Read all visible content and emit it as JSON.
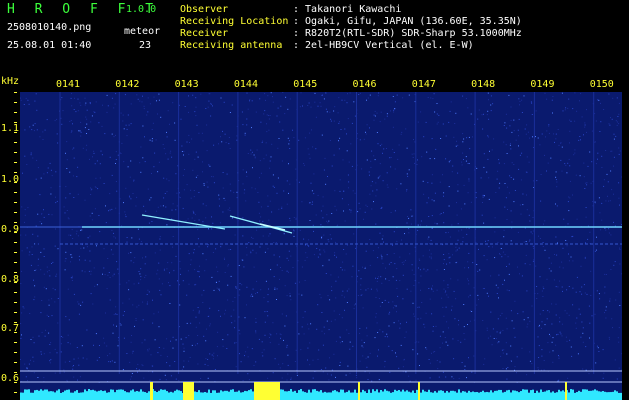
{
  "header": {
    "brand": "H R O F F T",
    "version": "1.0.0",
    "filename": "2508010140.png",
    "datetime": "25.08.01 01:40",
    "meteor_label": "meteor",
    "meteor_count": "23",
    "info": [
      {
        "label": "Observer",
        "value": ": Takanori Kawachi"
      },
      {
        "label": "Receiving Location",
        "value": ": Ogaki, Gifu, JAPAN (136.60E, 35.35N)"
      },
      {
        "label": "Receiver",
        "value": ": R820T2(RTL-SDR) SDR-Sharp 53.1000MHz"
      },
      {
        "label": "Receiving antenna",
        "value": ": 2el-HB9CV Vertical (el. E-W)"
      }
    ]
  },
  "axis": {
    "unit": "kHz",
    "time_ticks": [
      "0141",
      "0142",
      "0143",
      "0144",
      "0145",
      "0146",
      "0147",
      "0148",
      "0149",
      "0150"
    ],
    "freq_ticks": [
      "1.1",
      "1.0",
      "0.9",
      "0.8",
      "0.7",
      "0.6"
    ]
  },
  "colors": {
    "background": "#0a1a6e",
    "carrier": "#6fd4ff",
    "baseline": "#30e8ff",
    "burst": "#ffff33",
    "label": "#ffff33"
  }
}
